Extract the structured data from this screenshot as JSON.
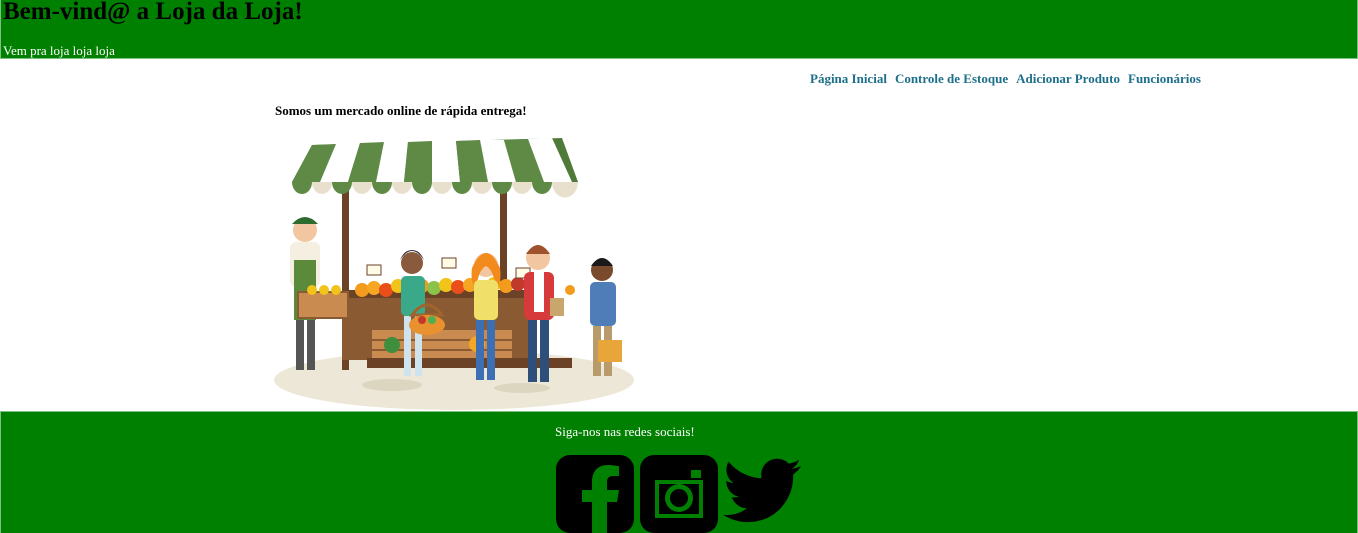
{
  "header": {
    "title": "Bem-vind@ a Loja da Loja!",
    "tagline": "Vem pra loja loja loja"
  },
  "nav": {
    "items": [
      {
        "label": "Página Inicial"
      },
      {
        "label": "Controle de Estoque"
      },
      {
        "label": "Adicionar Produto"
      },
      {
        "label": "Funcionários"
      }
    ]
  },
  "main": {
    "intro": "Somos um mercado online de rápida entrega!",
    "illustration_icon": "market-stall-illustration"
  },
  "footer": {
    "follow_text": "Siga-nos nas redes sociais!",
    "social": [
      {
        "icon": "facebook-icon"
      },
      {
        "icon": "instagram-icon"
      },
      {
        "icon": "twitter-icon"
      }
    ]
  },
  "colors": {
    "header_bg": "#008000",
    "footer_bg": "#008000",
    "nav_link": "#1e6f8a",
    "tagline": "#ffffff"
  }
}
